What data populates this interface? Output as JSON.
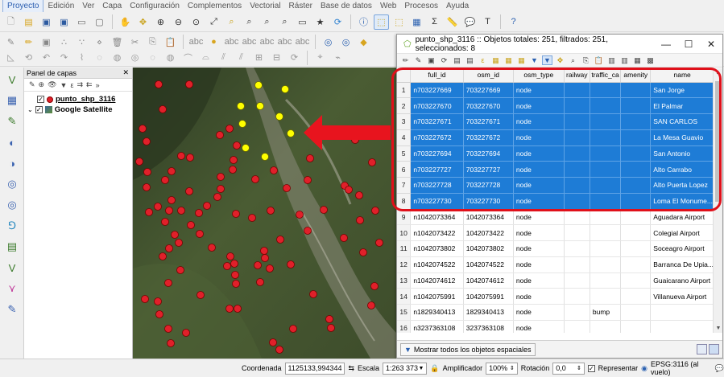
{
  "menu": [
    "Proyecto",
    "Edición",
    "Ver",
    "Capa",
    "Configuración",
    "Complementos",
    "Vectorial",
    "Ráster",
    "Base de datos",
    "Web",
    "Procesos",
    "Ayuda"
  ],
  "layers_panel": {
    "title": "Panel de capas",
    "layers": [
      {
        "name": "punto_shp_3116",
        "checked": true
      },
      {
        "name": "Google Satellite",
        "checked": true
      }
    ]
  },
  "attr_table": {
    "title": "punto_shp_3116 :: Objetos totales: 251, filtrados: 251, seleccionados: 8",
    "columns": [
      "full_id",
      "osm_id",
      "osm_type",
      "railway",
      "traffic_ca",
      "amenity",
      "name"
    ],
    "rows": [
      {
        "n": "1",
        "full_id": "n703227669",
        "osm_id": "703227669",
        "osm_type": "node",
        "railway": "",
        "traffic_ca": "",
        "amenity": "",
        "name": "San Jorge",
        "selected": true
      },
      {
        "n": "2",
        "full_id": "n703227670",
        "osm_id": "703227670",
        "osm_type": "node",
        "railway": "",
        "traffic_ca": "",
        "amenity": "",
        "name": "El Palmar",
        "selected": true
      },
      {
        "n": "3",
        "full_id": "n703227671",
        "osm_id": "703227671",
        "osm_type": "node",
        "railway": "",
        "traffic_ca": "",
        "amenity": "",
        "name": "SAN CARLOS",
        "selected": true
      },
      {
        "n": "4",
        "full_id": "n703227672",
        "osm_id": "703227672",
        "osm_type": "node",
        "railway": "",
        "traffic_ca": "",
        "amenity": "",
        "name": "La Mesa Guavio",
        "selected": true
      },
      {
        "n": "5",
        "full_id": "n703227694",
        "osm_id": "703227694",
        "osm_type": "node",
        "railway": "",
        "traffic_ca": "",
        "amenity": "",
        "name": "San Antonio",
        "selected": true
      },
      {
        "n": "6",
        "full_id": "n703227727",
        "osm_id": "703227727",
        "osm_type": "node",
        "railway": "",
        "traffic_ca": "",
        "amenity": "",
        "name": "Alto Carrabo",
        "selected": true
      },
      {
        "n": "7",
        "full_id": "n703227728",
        "osm_id": "703227728",
        "osm_type": "node",
        "railway": "",
        "traffic_ca": "",
        "amenity": "",
        "name": "Alto Puerta Lopez",
        "selected": true
      },
      {
        "n": "8",
        "full_id": "n703227730",
        "osm_id": "703227730",
        "osm_type": "node",
        "railway": "",
        "traffic_ca": "",
        "amenity": "",
        "name": "Loma El Monume...",
        "selected": true
      },
      {
        "n": "9",
        "full_id": "n1042073364",
        "osm_id": "1042073364",
        "osm_type": "node",
        "railway": "",
        "traffic_ca": "",
        "amenity": "",
        "name": "Aguadara Airport",
        "selected": false
      },
      {
        "n": "10",
        "full_id": "n1042073422",
        "osm_id": "1042073422",
        "osm_type": "node",
        "railway": "",
        "traffic_ca": "",
        "amenity": "",
        "name": "Colegial Airport",
        "selected": false
      },
      {
        "n": "11",
        "full_id": "n1042073802",
        "osm_id": "1042073802",
        "osm_type": "node",
        "railway": "",
        "traffic_ca": "",
        "amenity": "",
        "name": "Soceagro Airport",
        "selected": false
      },
      {
        "n": "12",
        "full_id": "n1042074522",
        "osm_id": "1042074522",
        "osm_type": "node",
        "railway": "",
        "traffic_ca": "",
        "amenity": "",
        "name": "Barranca De Upia...",
        "selected": false
      },
      {
        "n": "13",
        "full_id": "n1042074612",
        "osm_id": "1042074612",
        "osm_type": "node",
        "railway": "",
        "traffic_ca": "",
        "amenity": "",
        "name": "Guaicarano Airport",
        "selected": false
      },
      {
        "n": "14",
        "full_id": "n1042075991",
        "osm_id": "1042075991",
        "osm_type": "node",
        "railway": "",
        "traffic_ca": "",
        "amenity": "",
        "name": "Villanueva Airport",
        "selected": false
      },
      {
        "n": "15",
        "full_id": "n1829340413",
        "osm_id": "1829340413",
        "osm_type": "node",
        "railway": "",
        "traffic_ca": "bump",
        "amenity": "",
        "name": "",
        "selected": false
      },
      {
        "n": "16",
        "full_id": "n3237363108",
        "osm_id": "3237363108",
        "osm_type": "node",
        "railway": "",
        "traffic_ca": "",
        "amenity": "",
        "name": "",
        "selected": false
      }
    ],
    "filter_button": "Mostrar todos los objetos espaciales"
  },
  "statusbar": {
    "coord_label": "Coordenada",
    "coord_value": "1125133,994344",
    "scale_label": "Escala",
    "scale_value": "1:263 373",
    "magnifier_label": "Amplificador",
    "magnifier_value": "100%",
    "rotation_label": "Rotación",
    "rotation_value": "0,0",
    "render_label": "Representar",
    "crs": "EPSG:3116 (al vuelo)"
  },
  "colors": {
    "selection": "#1e7cd6",
    "point_red": "#e0202a",
    "point_selected": "#ffff00",
    "highlight": "#e0101a"
  }
}
